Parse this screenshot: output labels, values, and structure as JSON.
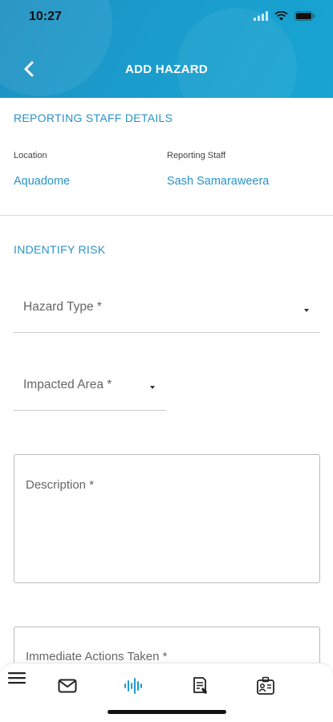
{
  "status_bar": {
    "time": "10:27"
  },
  "header": {
    "title": "ADD HAZARD"
  },
  "reporting": {
    "section_title": "REPORTING STAFF DETAILS",
    "location_label": "Location",
    "location_value": "Aquadome",
    "staff_label": "Reporting Staff",
    "staff_value": "Sash Samaraweera"
  },
  "risk": {
    "section_title": "INDENTIFY RISK",
    "hazard_type_placeholder": "Hazard Type *",
    "impacted_area_placeholder": "Impacted Area *",
    "description_placeholder": "Description *",
    "actions_placeholder": "Immediate Actions Taken *"
  },
  "tabbar": {
    "items": [
      {
        "icon": "menu-icon"
      },
      {
        "icon": "mail-icon"
      },
      {
        "icon": "activity-icon",
        "active": true
      },
      {
        "icon": "document-pen-icon"
      },
      {
        "icon": "id-badge-icon"
      }
    ],
    "active_color": "#1e9bd3"
  },
  "colors": {
    "accent": "#2a93c6",
    "header": "#1a9ccc"
  }
}
